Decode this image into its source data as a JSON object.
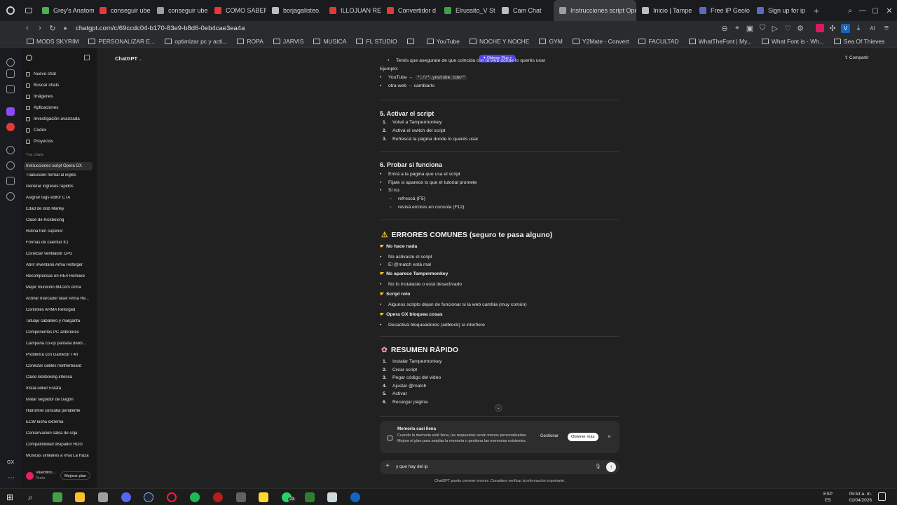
{
  "browser": {
    "tabs": [
      {
        "label": "Grey's Anatom",
        "color": "#4caf50"
      },
      {
        "label": "conseguir ube",
        "color": "#e53935"
      },
      {
        "label": "conseguir ube",
        "color": "#9e9e9e"
      },
      {
        "label": "COMO SABER",
        "color": "#e53935"
      },
      {
        "label": "borjagalisteo.",
        "color": "#bdbdbd"
      },
      {
        "label": "ILLOJUAN RE",
        "color": "#e53935"
      },
      {
        "label": "Convertidor d",
        "color": "#e53935"
      },
      {
        "label": "Elrussito_V St",
        "color": "#43a047"
      },
      {
        "label": "Cam Chat",
        "color": "#bdbdbd"
      },
      {
        "label": "Instrucciones script Ope",
        "color": "#9e9e9e",
        "active": true
      },
      {
        "label": "Inicio | Tampe",
        "color": "#bdbdbd"
      },
      {
        "label": "Free IP Geolo",
        "color": "#5c6bc0"
      },
      {
        "label": "Sign up for ip",
        "color": "#5c6bc0"
      }
    ],
    "url": "chatgpt.com/c/69ccdc04-b170-83e9-b8d6-0eb4cae3ea4a",
    "bookmarks": [
      "MODS SKYRIM",
      "PERSONALIZAR E...",
      "optimizar pc y acti...",
      "ROPA",
      "JARVIS",
      "MUSICA",
      "FL STUDIO",
      "",
      "YouTube",
      "NOCHE Y NOCHE",
      "GYM",
      "Y2Mate - Convert",
      "FACULTAD",
      "WhatTheFont | My...",
      "What Font is - Wh...",
      "Sea Of Thieves"
    ]
  },
  "sidebar": {
    "menu": [
      "Nuevo chat",
      "Buscar chats",
      "Imágenes",
      "Aplicaciones",
      "Investigación avanzada",
      "Codex",
      "Proyectos"
    ],
    "section_label": "Tus chats",
    "chats": [
      "Instrucciones script Opera GX",
      "Traducción formal al inglés",
      "Generar ingresos rápidos",
      "Asignar tags editor CTA",
      "Edad de Bob Marley",
      "Clase de Kickboxing",
      "Rutina tren superior",
      "Formas de calentar K1",
      "Conectar ventilador CPU",
      "Abrir inventario Arma Reforger",
      "Recompensas en RE4 Remake",
      "Mejor munición M4DAS Arma",
      "Activar marcador láser Arma Re...",
      "Controles ARMA Reforged",
      "Tatuaje caballero y margarita",
      "Componentes PC anteriores",
      "Campaña co-op pantalla dividi...",
      "Problema con GameSir T4n",
      "Conectar cables motherboard",
      "Clase kickboxing intensa",
      "InstaLooker Estafa",
      "Matar seguidor de Dagon",
      "Hidromiel consulta pendiente",
      "ECW lucha extrema",
      "Conservación salsa de soja",
      "Compatibilidad disipador ROG",
      "Musicas similares a Viva La Raza"
    ],
    "user_name": "Valentino...",
    "user_plan": "Gratis",
    "upgrade": "Mejorar plan"
  },
  "header": {
    "model": "ChatGPT",
    "share": "Compartir",
    "plus_badge": "Obtener Plus"
  },
  "content": {
    "intro": "Tenés que asegurate de que coincida con la web donde lo querés usar",
    "example_label": "Ejemplo:",
    "example_items": [
      "YouTube →",
      "otra web → cambiarlo"
    ],
    "example_code": "*://*.youtube.com/*",
    "s5_title": "5. Activar el script",
    "s5_items": [
      "Volvé a Tampermonkey",
      "Activá el switch del script",
      "Refrescá la página donde lo querés usar"
    ],
    "s6_title": "6. Probar si funciona",
    "s6_items": [
      "Entrá a la página que usa el script",
      "Fijate si aparece lo que el tutorial promete",
      "Si no:"
    ],
    "s6_sub": [
      "refrescá (F5)",
      "revisá errores en consola (F12)"
    ],
    "errors_title": "ERRORES COMUNES (seguro te pasa alguno)",
    "err1_title": "No hace nada",
    "err1_items": [
      "No activaste el script",
      "El @match está mal"
    ],
    "err2_title": "No aparece Tampermonkey",
    "err2_items": [
      "No lo instalaste o está desactivado"
    ],
    "err3_title": "Script roto",
    "err3_items": [
      "Algunos scripts dejan de funcionar si la web cambia (muy común)"
    ],
    "err4_title": "Opera GX bloquea cosas",
    "err4_items": [
      "Desactivá bloqueadores (adblock) si interfiere"
    ],
    "summary_title": "RESUMEN RÁPIDO",
    "summary_items": [
      "Instalar Tampermonkey",
      "Crear script",
      "Pegar código del video",
      "Ajustar @match",
      "Activar",
      "Recargar página"
    ]
  },
  "memory": {
    "title": "Memoria casi llena",
    "body": "Cuando la memoria esté llena, las respuestas serán menos personalizadas. Mejora el plan para ampliar la memoria o gestiona las memorias existentes.",
    "manage": "Gestionar",
    "more": "Obtener más"
  },
  "composer": {
    "value": "y que hay del ip",
    "disclaimer": "ChatGPT puede cometer errores. Considera verificar la información importante."
  },
  "taskbar": {
    "lang": "ESP",
    "region": "ES",
    "time": "05:53 a. m.",
    "date": "01/04/2026",
    "badge": "23"
  }
}
